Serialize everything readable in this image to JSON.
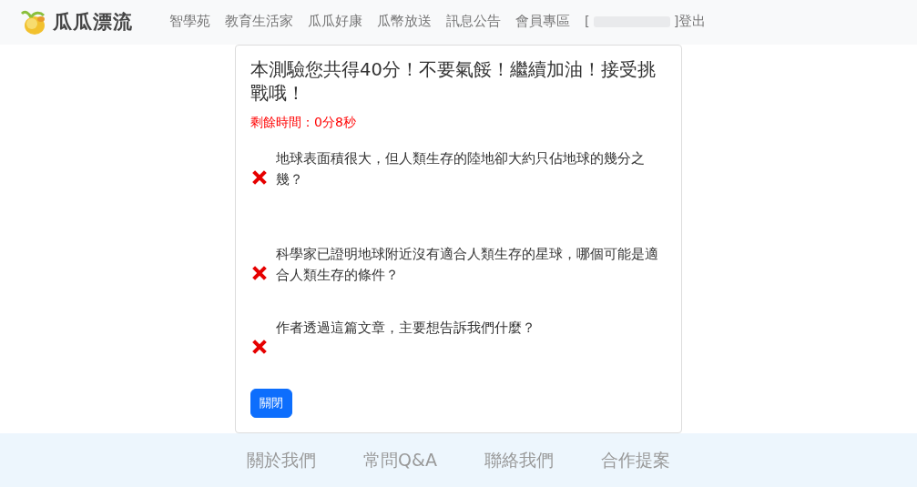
{
  "brand": {
    "name": "瓜瓜漂流"
  },
  "nav": {
    "items": [
      "智學苑",
      "教育生活家",
      "瓜瓜好康",
      "瓜幣放送",
      "訊息公告",
      "會員專區"
    ],
    "user": {
      "open": "[",
      "close": "]",
      "logout": "登出"
    }
  },
  "result": {
    "title": "本測驗您共得40分！不要氣餒！繼續加油！接受挑戰哦！",
    "timer": "剩餘時間：0分8秒",
    "questions": [
      {
        "text": "地球表面積很大，但人類生存的陸地卻大約只佔地球的幾分之幾？",
        "correct": false
      },
      {
        "text": "科學家已證明地球附近沒有適合人類生存的星球，哪個可能是適合人類生存的條件？",
        "correct": false
      },
      {
        "text": "作者透過這篇文章，主要想告訴我們什麼？",
        "correct": false
      }
    ],
    "close_button": "關閉"
  },
  "footer": {
    "links": [
      "關於我們",
      "常問Q&A",
      "聯絡我們",
      "合作提案"
    ]
  }
}
